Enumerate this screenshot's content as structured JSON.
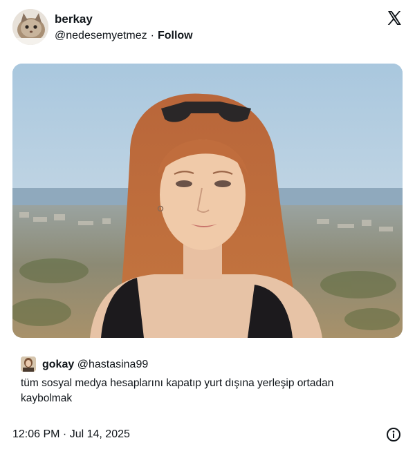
{
  "author": {
    "display_name": "berkay",
    "handle": "@nedesemyetmez",
    "separator": "·",
    "follow_label": "Follow"
  },
  "brand": {
    "logo_icon": "x-logo-icon"
  },
  "quoted": {
    "display_name": "gokay",
    "handle": "@hastasina99",
    "text": "tüm sosyal medya hesaplarını kapatıp yurt dışına yerleşip ortadan kaybolmak"
  },
  "footer": {
    "timestamp": "12:06 PM · Jul 14, 2025",
    "info_icon": "info-icon"
  },
  "colors": {
    "text": "#0f1419",
    "sky": "#bcd2e4",
    "hair": "#b5582a"
  }
}
